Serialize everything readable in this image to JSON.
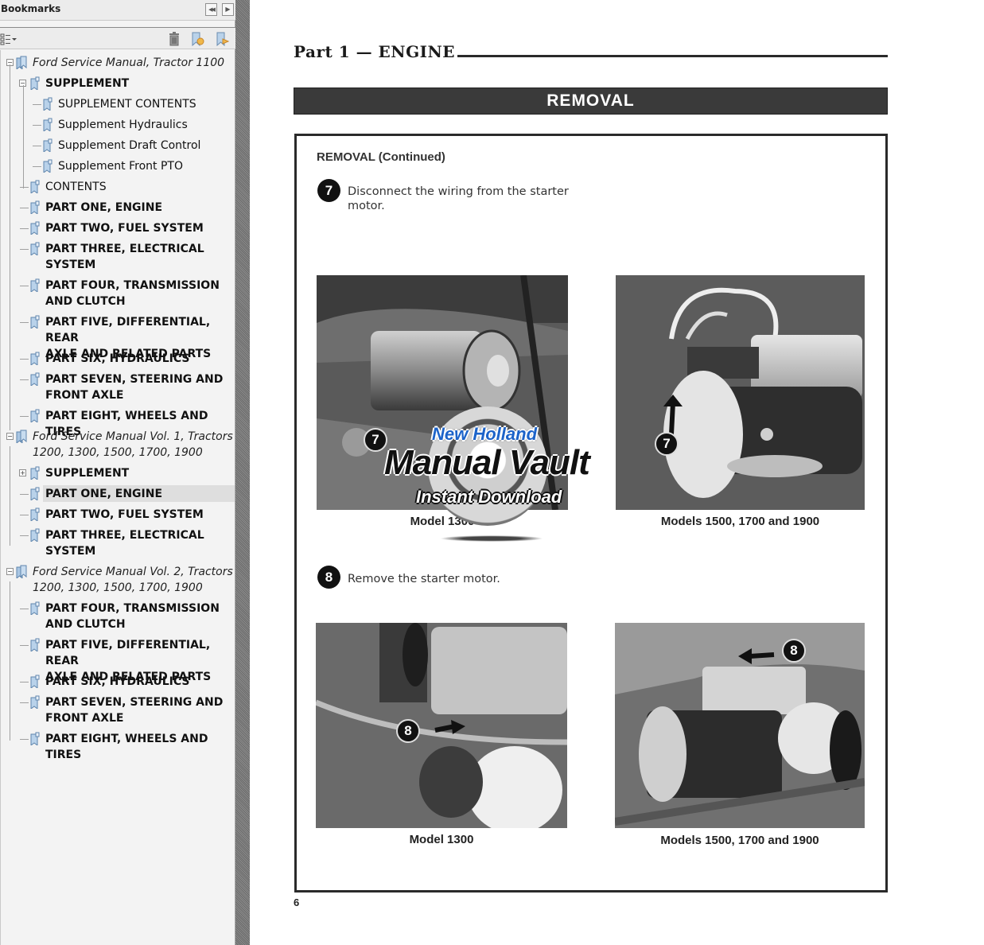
{
  "sidebar": {
    "title": "Bookmarks",
    "header_buttons": {
      "collapse": "◀◀",
      "expand": "▶"
    },
    "toolbar": {
      "options_icon": "options-menu-icon",
      "delete_icon": "trash-icon",
      "new_bookmark_icon": "new-bookmark-icon",
      "expand_bookmark_icon": "expand-current-bookmark-icon"
    },
    "items": [
      {
        "label": "Ford Service Manual, Tractor 1100",
        "level": 0,
        "style": "root",
        "expander": "−"
      },
      {
        "label": "SUPPLEMENT",
        "level": 1,
        "style": "bold",
        "expander": "−"
      },
      {
        "label": "SUPPLEMENT CONTENTS",
        "level": 2,
        "style": "plain"
      },
      {
        "label": "Supplement Hydraulics",
        "level": 2,
        "style": "plain"
      },
      {
        "label": "Supplement Draft Control",
        "level": 2,
        "style": "plain"
      },
      {
        "label": "Supplement Front PTO",
        "level": 2,
        "style": "plain"
      },
      {
        "label": "CONTENTS",
        "level": 1,
        "style": "plain"
      },
      {
        "label": "PART ONE, ENGINE",
        "level": 1,
        "style": "bold"
      },
      {
        "label": "PART TWO, FUEL SYSTEM",
        "level": 1,
        "style": "bold"
      },
      {
        "label": "PART THREE, ELECTRICAL\nSYSTEM",
        "level": 1,
        "style": "bold"
      },
      {
        "label": "PART FOUR, TRANSMISSION\nAND CLUTCH",
        "level": 1,
        "style": "bold"
      },
      {
        "label": "PART FIVE, DIFFERENTIAL, REAR\nAXLE AND RELATED PARTS",
        "level": 1,
        "style": "bold"
      },
      {
        "label": "PART SIX, HYDRAULICS",
        "level": 1,
        "style": "bold"
      },
      {
        "label": "PART SEVEN, STEERING AND\nFRONT AXLE",
        "level": 1,
        "style": "bold"
      },
      {
        "label": "PART EIGHT, WHEELS AND TIRES",
        "level": 1,
        "style": "bold"
      },
      {
        "label": "Ford Service Manual Vol. 1, Tractors\n1200, 1300, 1500, 1700, 1900",
        "level": 0,
        "style": "root",
        "expander": "−"
      },
      {
        "label": "SUPPLEMENT",
        "level": 1,
        "style": "bold",
        "expander": "+"
      },
      {
        "label": "PART ONE, ENGINE",
        "level": 1,
        "style": "bold",
        "selected": true
      },
      {
        "label": "PART TWO, FUEL SYSTEM",
        "level": 1,
        "style": "bold"
      },
      {
        "label": "PART THREE, ELECTRICAL\nSYSTEM",
        "level": 1,
        "style": "bold"
      },
      {
        "label": "Ford Service Manual Vol. 2, Tractors\n1200, 1300, 1500, 1700, 1900",
        "level": 0,
        "style": "root",
        "expander": "−"
      },
      {
        "label": "PART FOUR, TRANSMISSION\nAND CLUTCH",
        "level": 1,
        "style": "bold"
      },
      {
        "label": "PART FIVE, DIFFERENTIAL, REAR\nAXLE AND RELATED PARTS",
        "level": 1,
        "style": "bold"
      },
      {
        "label": "PART SIX, HYDRAULICS",
        "level": 1,
        "style": "bold"
      },
      {
        "label": "PART SEVEN, STEERING AND\nFRONT AXLE",
        "level": 1,
        "style": "bold"
      },
      {
        "label": "PART EIGHT, WHEELS AND TIRES",
        "level": 1,
        "style": "bold"
      }
    ]
  },
  "document": {
    "part_title": "Part 1 — ENGINE",
    "section_banner": "REMOVAL",
    "subheading": "REMOVAL (Continued)",
    "steps": [
      {
        "number": "7",
        "text": "Disconnect the wiring from the starter\nmotor.",
        "figures": [
          {
            "caption": "Model 1300",
            "callout": "7"
          },
          {
            "caption": "Models 1500, 1700 and 1900",
            "callout": "7"
          }
        ]
      },
      {
        "number": "8",
        "text": "Remove the starter motor.",
        "figures": [
          {
            "caption": "Model 1300",
            "callout": "8"
          },
          {
            "caption": "Models 1500, 1700 and 1900",
            "callout": "8"
          }
        ]
      }
    ],
    "page_number": "6",
    "watermark": {
      "line1": "New Holland",
      "line2": "Manual Vault",
      "line3": "Instant Download",
      "accent_color": "#1c63c9"
    }
  }
}
